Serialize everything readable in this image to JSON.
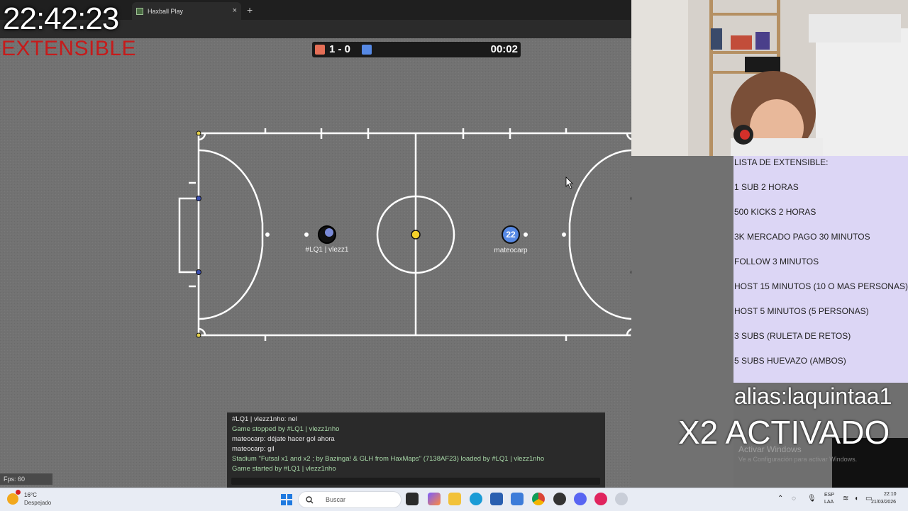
{
  "browser": {
    "tab_title": "Haxball Play",
    "tab_close": "×",
    "new_tab": "+"
  },
  "overlay": {
    "clock": "22:42:23",
    "extensible_label": "EXTENSIBLE"
  },
  "scoreboard": {
    "score": "1 - 0",
    "time": "00:02",
    "red_color": "#e56e56",
    "blue_color": "#5689e5"
  },
  "players": {
    "red": {
      "avatar": "",
      "name": "#LQ1 | vlezz1"
    },
    "blue": {
      "avatar": "22",
      "name": "mateocarp"
    }
  },
  "chat": {
    "lines": [
      {
        "text": "#LQ1 | vlezz1nho: nel",
        "kind": "white"
      },
      {
        "text": "Game stopped by #LQ1 | vlezz1nho",
        "kind": "green"
      },
      {
        "text": "mateocarp: déjate hacer gol ahora",
        "kind": "white"
      },
      {
        "text": "mateocarp: gil",
        "kind": "white"
      },
      {
        "text": "Stadium \"Futsal x1 and x2 ; by Bazinga! & GLH from HaxMaps\" (7138AF23) loaded by #LQ1 | vlezz1nho",
        "kind": "green"
      },
      {
        "text": "Game started by #LQ1 | vlezz1nho",
        "kind": "green"
      }
    ]
  },
  "fps": "Fps: 60",
  "extensible_list": {
    "items": [
      "LISTA DE EXTENSIBLE:",
      "1 SUB 2 HORAS",
      "500 KICKS 2 HORAS",
      "3K MERCADO PAGO 30 MINUTOS",
      "FOLLOW 3 MINUTOS",
      "HOST 15 MINUTOS (10 O MAS PERSONAS)",
      "HOST 5 MINUTOS (5 PERSONAS)",
      "3 SUBS (RULETA DE RETOS)",
      "5 SUBS HUEVAZO (AMBOS)"
    ]
  },
  "alias": "alias:laquintaa1",
  "x2": "X2 ACTIVADO",
  "windows_activation": {
    "title": "Activar Windows",
    "subtitle": "Ve a Configuración para activar Windows."
  },
  "taskbar": {
    "weather_temp": "16°C",
    "weather_desc": "Despejado",
    "search_placeholder": "Buscar",
    "lang_1": "ESP",
    "lang_2": "LAA",
    "time": "22:10",
    "date": "21/03/2026"
  }
}
